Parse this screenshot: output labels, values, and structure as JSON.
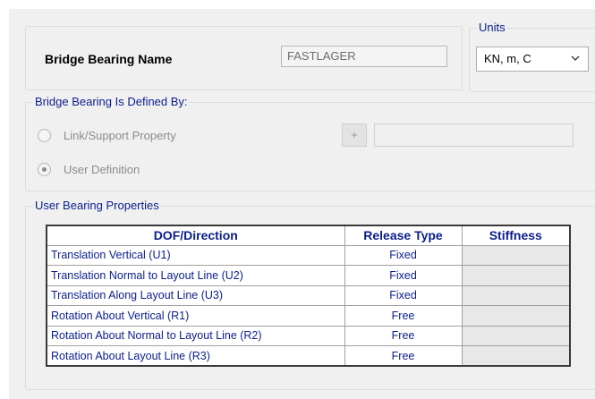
{
  "bearing_name": {
    "label": "Bridge Bearing Name",
    "value": "FASTLAGER"
  },
  "units": {
    "legend": "Units",
    "selected": "KN, m, C"
  },
  "defined_by": {
    "legend": "Bridge Bearing Is Defined By:",
    "options": [
      {
        "label": "Link/Support Property",
        "checked": false
      },
      {
        "label": "User Definition",
        "checked": true
      }
    ],
    "plus_label": "+"
  },
  "user_properties": {
    "legend": "User Bearing Properties",
    "columns": [
      "DOF/Direction",
      "Release Type",
      "Stiffness"
    ],
    "rows": [
      {
        "dof": "Translation Vertical (U1)",
        "release": "Fixed",
        "stiffness": ""
      },
      {
        "dof": "Translation Normal to Layout Line (U2)",
        "release": "Fixed",
        "stiffness": ""
      },
      {
        "dof": "Translation Along Layout Line (U3)",
        "release": "Fixed",
        "stiffness": ""
      },
      {
        "dof": "Rotation About Vertical (R1)",
        "release": "Free",
        "stiffness": ""
      },
      {
        "dof": "Rotation About Normal to Layout Line (R2)",
        "release": "Free",
        "stiffness": ""
      },
      {
        "dof": "Rotation About Layout Line (R3)",
        "release": "Free",
        "stiffness": ""
      }
    ]
  },
  "colors": {
    "label_blue": "#0a1e8c",
    "panel_bg": "#f0f0f0"
  }
}
